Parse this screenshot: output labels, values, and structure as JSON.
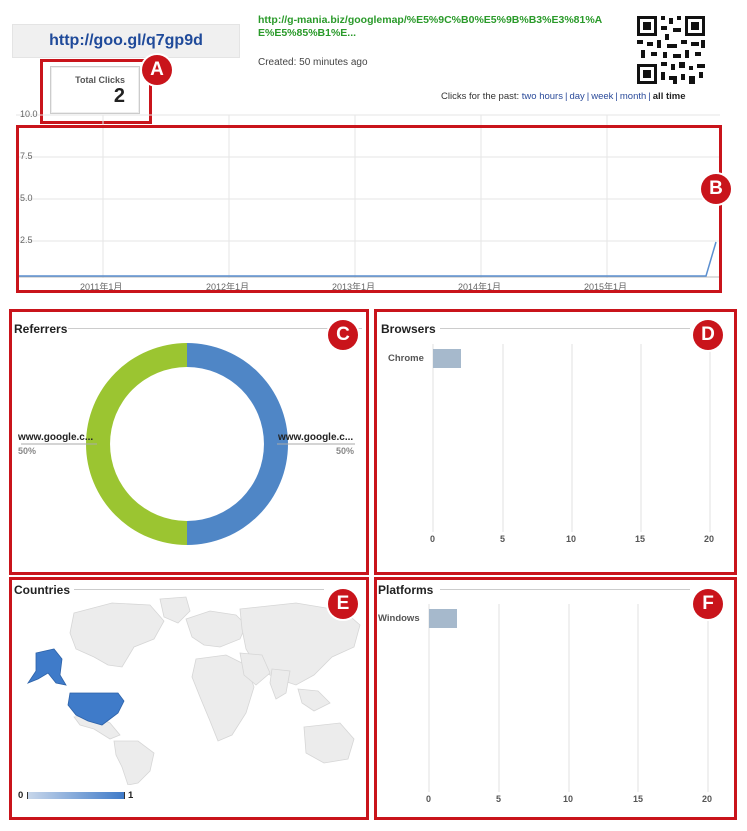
{
  "header": {
    "short_url": "http://goo.gl/q7gp9d",
    "long_url": "http://g-mania.biz/googlemap/%E5%9C%B0%E5%9B%B3%E3%81%AE%E5%85%B1%E...",
    "created": "Created: 50 minutes ago"
  },
  "total_clicks": {
    "label": "Total Clicks",
    "value": "2"
  },
  "clicks_past": {
    "label": "Clicks for the past:",
    "options": [
      "two hours",
      "day",
      "week",
      "month",
      "all time"
    ],
    "active": "all time"
  },
  "badges": [
    "A",
    "B",
    "C",
    "D",
    "E",
    "F"
  ],
  "timeline": {
    "y_ticks": [
      "10.0",
      "7.5",
      "5.0",
      "2.5"
    ],
    "x_ticks": [
      "2011年1月",
      "2012年1月",
      "2013年1月",
      "2014年1月",
      "2015年1月"
    ],
    "line_color": "#5b8fd0"
  },
  "referrers": {
    "title": "Referrers",
    "slices": [
      {
        "name": "www.google.c...",
        "percent": "50%",
        "value": 50,
        "color": "#4f86c6"
      },
      {
        "name": "www.google.c...",
        "percent": "50%",
        "value": 50,
        "color": "#9bc531"
      }
    ]
  },
  "browsers": {
    "title": "Browsers",
    "items": [
      {
        "name": "Chrome",
        "value": 2
      }
    ],
    "x_ticks": [
      "0",
      "5",
      "10",
      "15",
      "20"
    ],
    "bar_color": "#a6b9cc"
  },
  "countries": {
    "title": "Countries",
    "legend_min": "0",
    "legend_max": "1",
    "highlight_color": "#3f7bc9"
  },
  "platforms": {
    "title": "Platforms",
    "items": [
      {
        "name": "Windows",
        "value": 2
      }
    ],
    "x_ticks": [
      "0",
      "5",
      "10",
      "15",
      "20"
    ],
    "bar_color": "#a6b9cc"
  }
}
